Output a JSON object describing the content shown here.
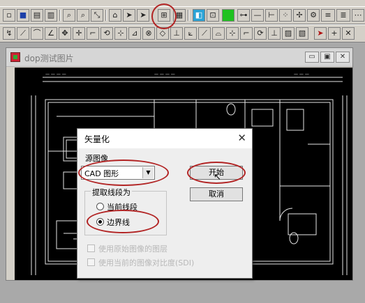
{
  "toolbar_icons_row1": [
    "new-file-icon",
    "save-icon",
    "open-icon",
    "print-icon",
    "zoom-in-icon",
    "zoom-out-icon",
    "magic-wand-icon",
    "erase-icon",
    "select-arrow-icon",
    "vectorize-icon",
    "grid-icon",
    "image-icon",
    "fit-icon",
    "fill-icon",
    "node-icon",
    "line-icon",
    "branch-icon",
    "cross-icon",
    "settings-icon",
    "abc-icon",
    "abc-bold-icon"
  ],
  "toolbar_icons_row2": [
    "draw-tool-icon",
    "line-tool-icon",
    "arc-tool-icon",
    "angle-tool-icon",
    "move-tool-icon",
    "corner-tool-icon",
    "rotate-tool-icon",
    "snap-tool-icon",
    "skew-tool-icon",
    "trim-tool-icon",
    "extend-tool-icon",
    "measure-tool-icon",
    "box-tool-icon",
    "pointer-icon",
    "plus-icon",
    "cross-hair-icon"
  ],
  "doc_window": {
    "title": "dop测试图片",
    "minimize": "▭",
    "restore": "▣",
    "close": "✕"
  },
  "dialog": {
    "title": "矢量化",
    "close": "✕",
    "source_label": "源图像",
    "source_value": "CAD 图形",
    "group_label": "提取线段为",
    "radio_current": "当前线段",
    "radio_boundary": "边界线",
    "start_button": "开始",
    "cancel_button": "取消",
    "option1": "使用原始图像的图层",
    "option2": "使用当前的图像对比度(SDI)",
    "selected_radio": "边界线"
  },
  "highlight_color": "#b22424"
}
